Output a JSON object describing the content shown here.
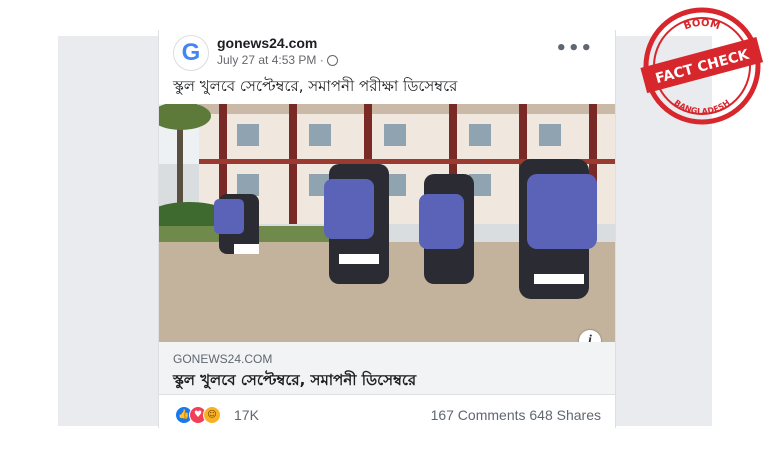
{
  "post": {
    "page_name": "gonews24.com",
    "avatar_letter": "G",
    "timestamp": "July 27 at 4:53 PM · ",
    "more_label": "•••",
    "caption": "স্কুল খুলবে সেপ্টেম্বরে, সমাপনী পরীক্ষা ডিসেম্বরে"
  },
  "link": {
    "domain": "GONEWS24.COM",
    "title": "স্কুল খুলবে সেপ্টেম্বরে, সমাপনী ডিসেম্বরে"
  },
  "engagement": {
    "reactions": [
      "like-icon",
      "love-icon",
      "haha-icon"
    ],
    "reaction_count": "17K",
    "comments": "167 Comments",
    "shares": "648 Shares"
  },
  "stamp": {
    "top": "BOOM",
    "middle": "FACT CHECK",
    "bottom": "BANGLADESH",
    "color": "#d7262c"
  },
  "colors": {
    "brand_blue": "#4285f4",
    "like": "#1877f2",
    "love": "#f33e58",
    "haha": "#f7b125"
  }
}
